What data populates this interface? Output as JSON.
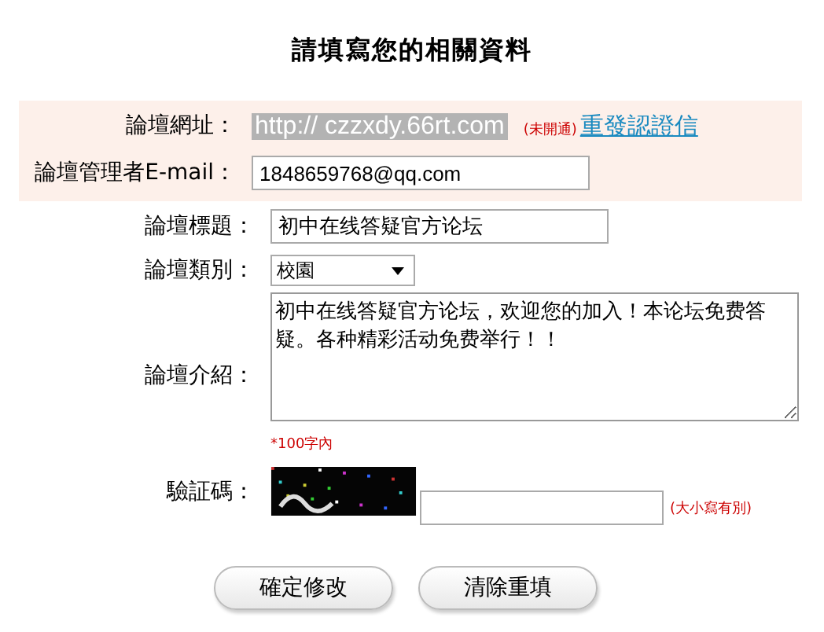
{
  "title": "請填寫您的相關資料",
  "fields": [
    {
      "kind": "url",
      "label": "論壇網址：",
      "value": "http:// czzxdy.66rt.com",
      "status": "(未開通)",
      "link": "重發認證信"
    },
    {
      "kind": "input",
      "label": "論壇管理者E-mail：",
      "value": "1848659768@qq.com"
    },
    {
      "kind": "input",
      "label": "論壇標題：",
      "value": "初中在线答疑官方论坛"
    },
    {
      "kind": "select",
      "label": "論壇類別：",
      "value": "校園"
    },
    {
      "kind": "textarea",
      "label": "論壇介紹：",
      "value": "初中在线答疑官方论坛，欢迎您的加入！本论坛免费答疑。各种精彩活动免费举行！！",
      "note": "*100字內"
    },
    {
      "kind": "captcha",
      "label": "驗証碼：",
      "hint": "(大小寫有別)"
    }
  ],
  "buttons": [
    "確定修改",
    "清除重填"
  ]
}
